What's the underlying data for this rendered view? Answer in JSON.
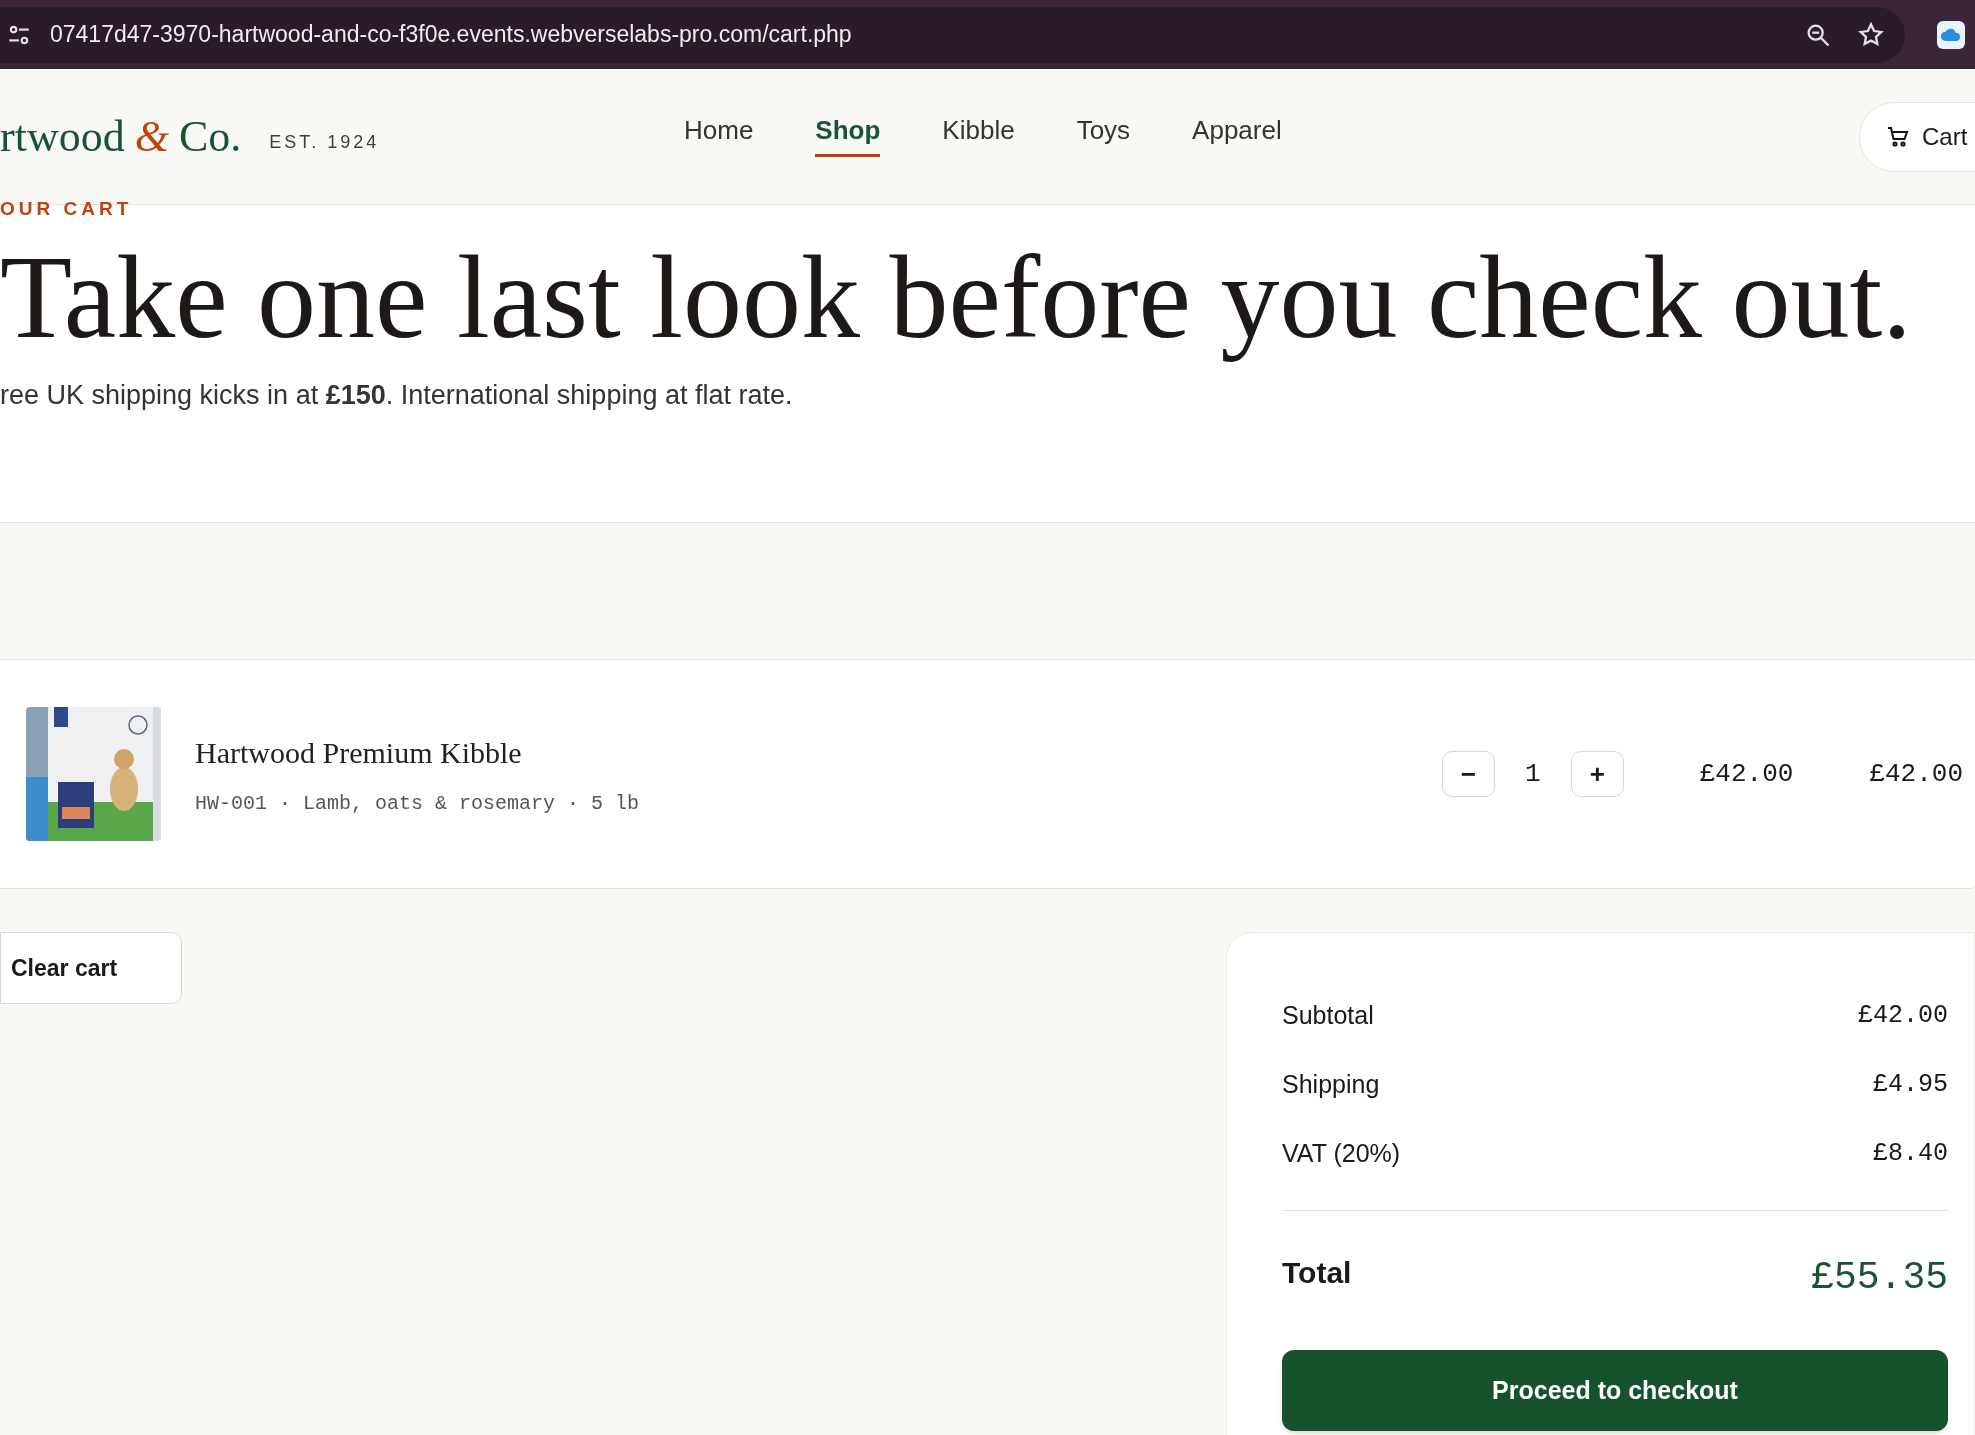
{
  "browser": {
    "url": "07417d47-3970-hartwood-and-co-f3f0e.events.webverselabs-pro.com/cart.php"
  },
  "header": {
    "logo": {
      "name": "rtwood",
      "amp": "&",
      "suffix": "Co."
    },
    "est": "EST. 1924",
    "nav": [
      {
        "label": "Home",
        "selected": false
      },
      {
        "label": "Shop",
        "selected": true
      },
      {
        "label": "Kibble",
        "selected": false
      },
      {
        "label": "Toys",
        "selected": false
      },
      {
        "label": "Apparel",
        "selected": false
      }
    ],
    "cart": "Cart"
  },
  "hero": {
    "eyebrow": "OUR CART",
    "title": "Take one last look before you check out.",
    "subtitle": "ree UK shipping kicks in at **£150**. International shipping at flat rate."
  },
  "items": [
    {
      "name": "Hartwood Premium Kibble",
      "details": "HW-001 · Lamb, oats & rosemary · 5 lb",
      "minus": "−",
      "quantity": "1",
      "plus": "+",
      "price": "£42.00",
      "line_total": "£42.00"
    }
  ],
  "clear_button": "Clear cart",
  "summary": {
    "rows": [
      {
        "label": "Subtotal",
        "value": "£42.00"
      },
      {
        "label": "Shipping",
        "value": "£4.95"
      },
      {
        "label": "VAT (20%)",
        "value": "£8.40"
      }
    ],
    "total": {
      "label": "Total",
      "value": "£55.35"
    },
    "checkout": "Proceed to checkout"
  }
}
